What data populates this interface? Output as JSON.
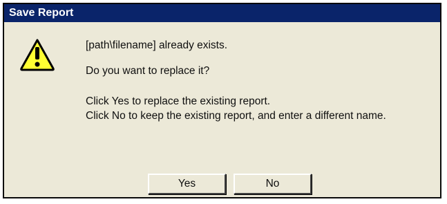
{
  "dialog": {
    "title": "Save Report",
    "icon": "warning-icon",
    "colors": {
      "titlebar": "#0a246a",
      "body": "#ece9d8",
      "warning_fill": "#ffff33"
    },
    "message": {
      "exists": "[path\\filename]  already exists.",
      "question": "Do you want to replace it?",
      "yes_hint": "Click Yes to replace the existing report.",
      "no_hint": "Click No to keep the existing report, and enter a different name."
    },
    "buttons": {
      "yes_label": "Yes",
      "no_label": "No"
    }
  }
}
